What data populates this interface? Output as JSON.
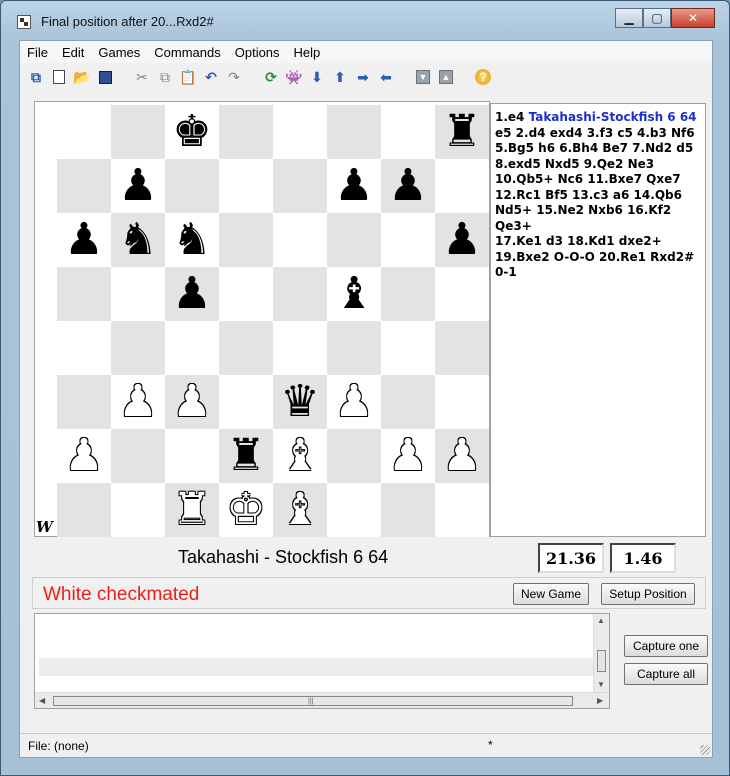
{
  "window": {
    "title": "Final position after 20...Rxd2#",
    "buttons": {
      "minimize": "▁",
      "maximize": "▢",
      "close": "✕"
    }
  },
  "menu": [
    "File",
    "Edit",
    "Games",
    "Commands",
    "Options",
    "Help"
  ],
  "toolbar": [
    {
      "name": "copy-game-icon",
      "glyph": "⧉"
    },
    {
      "name": "new-doc-icon",
      "glyph": ""
    },
    {
      "name": "open-icon",
      "glyph": "📂"
    },
    {
      "name": "save-icon",
      "glyph": ""
    },
    {
      "name": "cut-icon",
      "glyph": "✂"
    },
    {
      "name": "copy-icon",
      "glyph": "⧉"
    },
    {
      "name": "paste-icon",
      "glyph": "📋"
    },
    {
      "name": "undo-icon",
      "glyph": "↶"
    },
    {
      "name": "redo-icon",
      "glyph": "↷"
    },
    {
      "name": "refresh-icon",
      "glyph": "⟳"
    },
    {
      "name": "engine-icon",
      "glyph": "👾"
    },
    {
      "name": "arrow-down-icon",
      "glyph": "⬇"
    },
    {
      "name": "arrow-up-icon",
      "glyph": "⬆"
    },
    {
      "name": "arrow-right-icon",
      "glyph": "➡"
    },
    {
      "name": "arrow-left-icon",
      "glyph": "⬅"
    },
    {
      "name": "scroll-down-icon",
      "glyph": "▼"
    },
    {
      "name": "scroll-up-icon",
      "glyph": "▲"
    },
    {
      "name": "help-icon",
      "glyph": "?"
    }
  ],
  "board": {
    "side_to_move": "W",
    "ranks": [
      "..k....r",
      ".p...pp.",
      "pnn....p",
      "..p..b..",
      "........",
      ".PP.qP..",
      "P..rB.PP",
      "..RKB..."
    ]
  },
  "moves": {
    "header_moves": "1.e4",
    "header_players": "Takahashi-Stockfish 6 64",
    "lines": [
      "e5 2.d4 exd4 3.f3 c5 4.b3 Nf6",
      "5.Bg5 h6 6.Bh4 Be7 7.Nd2 d5",
      "8.exd5 Nxd5 9.Qe2 Ne3",
      "10.Qb5+ Nc6 11.Bxe7 Qxe7",
      "12.Rc1 Bf5 13.c3 a6 14.Qb6",
      "Nd5+ 15.Ne2 Nxb6 16.Kf2 Qe3+",
      "17.Ke1 d3 18.Kd1 dxe2+",
      "19.Bxe2 O-O-O 20.Re1 Rxd2#",
      "0-1"
    ]
  },
  "game": {
    "players": "Takahashi - Stockfish 6 64",
    "clock_white": "21.36",
    "clock_black": "1.46",
    "status": "White checkmated",
    "new_game_label": "New Game",
    "setup_position_label": "Setup Position",
    "capture_one_label": "Capture one",
    "capture_all_label": "Capture all"
  },
  "statusbar": {
    "file": "File: (none)",
    "modified": "*"
  },
  "colors": {
    "status_text": "#e8221b",
    "moves_header": "#1c2fcc",
    "dark_square": "#e3e3e3",
    "light_square": "#ffffff"
  }
}
